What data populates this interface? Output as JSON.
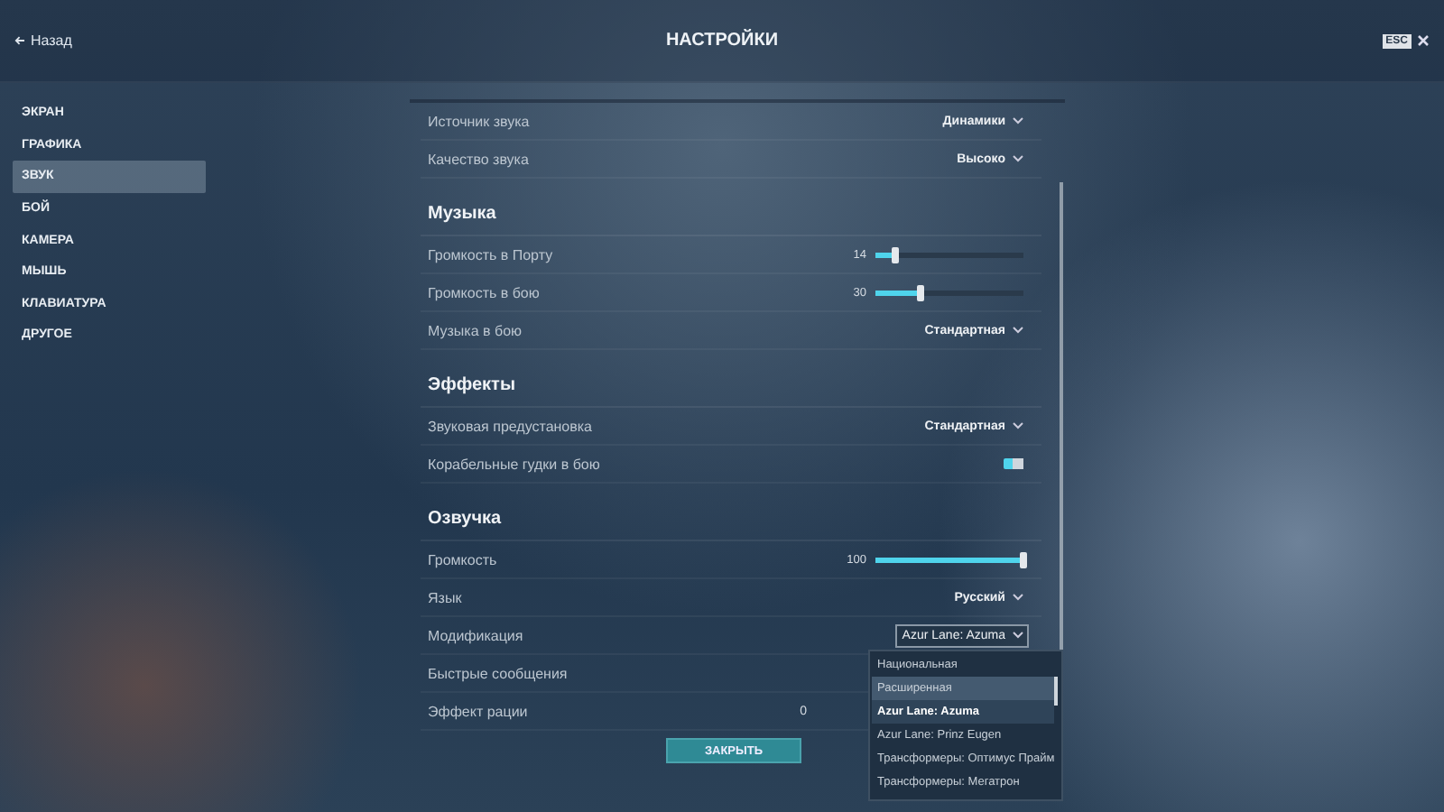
{
  "header": {
    "back": "Назад",
    "title": "НАСТРОЙКИ",
    "esc_key": "ESC"
  },
  "sidebar": {
    "items": [
      {
        "label": "ЭКРАН",
        "selected": false
      },
      {
        "label": "ГРАФИКА",
        "selected": false
      },
      {
        "label": "ЗВУК",
        "selected": true
      },
      {
        "label": "БОЙ",
        "selected": false
      },
      {
        "label": "КАМЕРА",
        "selected": false
      },
      {
        "label": "МЫШЬ",
        "selected": false
      },
      {
        "label": "КЛАВИАТУРА",
        "selected": false
      },
      {
        "label": "ДРУГОЕ",
        "selected": false
      }
    ]
  },
  "sections": [
    {
      "rows": [
        {
          "kind": "select",
          "label": "Источник звука",
          "value": "Динамики",
          "expanded": false
        },
        {
          "kind": "select",
          "label": "Качество звука",
          "value": "Высоко",
          "expanded": false
        }
      ]
    },
    {
      "title": "Музыка",
      "rows": [
        {
          "kind": "slider",
          "label": "Громкость в Порту",
          "reading": "14",
          "level": 0.14
        },
        {
          "kind": "slider",
          "label": "Громкость в бою",
          "reading": "30",
          "level": 0.3
        },
        {
          "kind": "select",
          "label": "Музыка в бою",
          "value": "Стандартная",
          "expanded": false
        }
      ]
    },
    {
      "title": "Эффекты",
      "rows": [
        {
          "kind": "select",
          "label": "Звуковая предустановка",
          "value": "Стандартная",
          "expanded": false
        },
        {
          "kind": "toggle",
          "label": "Корабельные гудки в бою",
          "on": true
        }
      ]
    },
    {
      "title": "Озвучка",
      "rows": [
        {
          "kind": "slider",
          "label": "Громкость",
          "reading": "100",
          "level": 1
        },
        {
          "kind": "select",
          "label": "Язык",
          "value": "Русский",
          "expanded": false
        },
        {
          "kind": "select",
          "label": "Модификация",
          "value": "Azur Lane: Azuma",
          "expanded": true,
          "options": [
            {
              "label": "Национальная",
              "selected": false,
              "hovered": false
            },
            {
              "label": "Расширенная",
              "selected": false,
              "hovered": true
            },
            {
              "label": "Azur Lane: Azuma",
              "selected": true,
              "hovered": false
            },
            {
              "label": "Azur Lane: Prinz Eugen",
              "selected": false,
              "hovered": false
            },
            {
              "label": "Трансформеры: Оптимус Прайм",
              "selected": false,
              "hovered": false
            },
            {
              "label": "Трансформеры: Мегатрон",
              "selected": false,
              "hovered": false
            }
          ]
        },
        {
          "kind": "plain",
          "label": "Быстрые сообщения"
        },
        {
          "kind": "reading",
          "label": "Эффект рации",
          "reading": "0"
        }
      ]
    }
  ],
  "close_button": "ЗАКРЫТЬ"
}
